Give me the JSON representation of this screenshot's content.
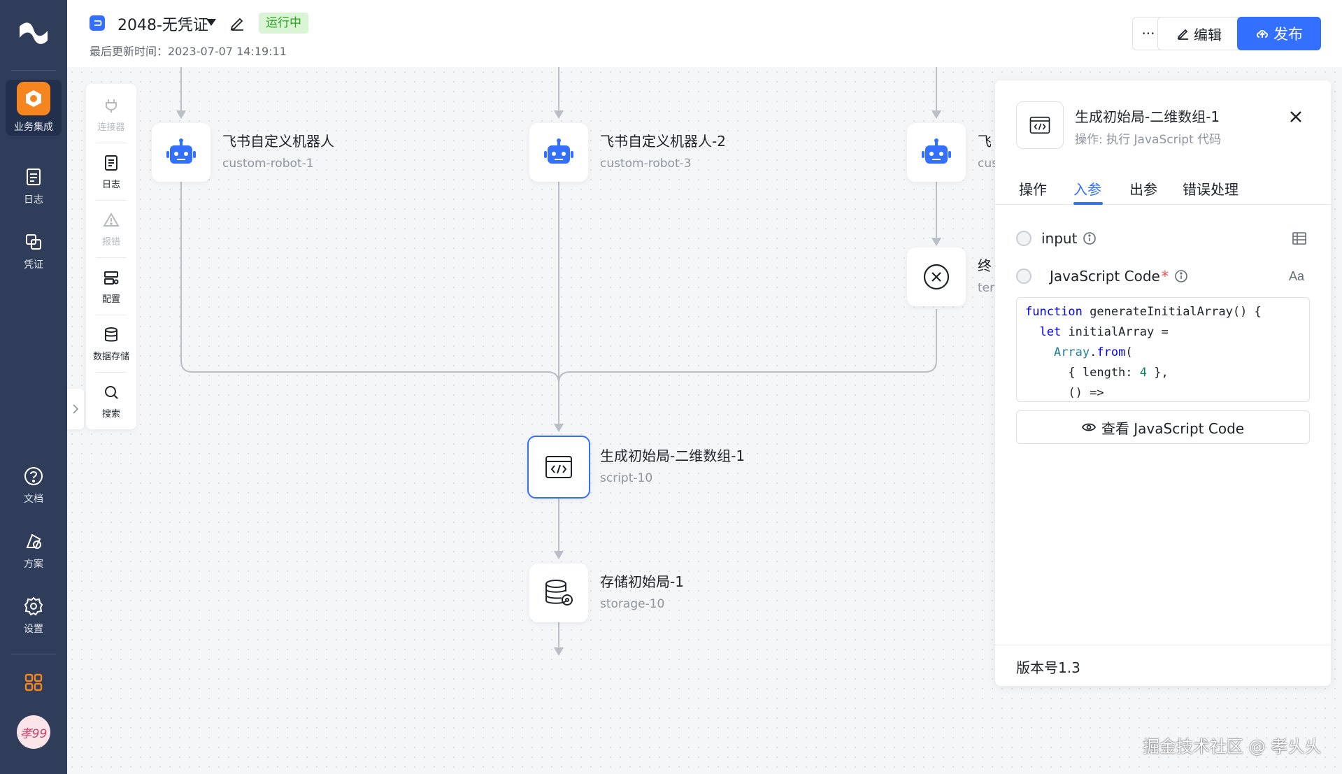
{
  "leftnav": {
    "items": [
      {
        "label": "业务集成",
        "icon": "integration-icon"
      },
      {
        "label": "日志",
        "icon": "log-icon"
      },
      {
        "label": "凭证",
        "icon": "credential-icon"
      },
      {
        "label": "文档",
        "icon": "help-icon"
      },
      {
        "label": "方案",
        "icon": "solution-icon"
      },
      {
        "label": "设置",
        "icon": "settings-icon"
      }
    ],
    "avatar_text": "孝99"
  },
  "header": {
    "app_icon": "app-flow-icon",
    "title": "2048-无凭证",
    "status": "运行中",
    "updated": "最后更新时间：2023-07-07 14:19:11",
    "more_label": "···",
    "edit_label": "编辑",
    "publish_label": "发布"
  },
  "tools": {
    "items": [
      {
        "label": "连接器",
        "icon": "plug-icon",
        "disabled": true
      },
      {
        "label": "日志",
        "icon": "log-icon",
        "disabled": false
      },
      {
        "label": "报错",
        "icon": "warning-icon",
        "disabled": true
      },
      {
        "label": "配置",
        "icon": "config-icon",
        "disabled": false
      },
      {
        "label": "数据存储",
        "icon": "database-icon",
        "disabled": false
      },
      {
        "label": "搜索",
        "icon": "search-icon",
        "disabled": false
      }
    ]
  },
  "nodes": {
    "robot1": {
      "title": "飞书自定义机器人",
      "sub": "custom-robot-1"
    },
    "robot3": {
      "title": "飞书自定义机器人-2",
      "sub": "custom-robot-3"
    },
    "robot_partial": {
      "title": "飞",
      "sub": "cus"
    },
    "terminate": {
      "title": "终",
      "sub": "ter"
    },
    "script": {
      "title": "生成初始局-二维数组-1",
      "sub": "script-10"
    },
    "storage": {
      "title": "存储初始局-1",
      "sub": "storage-10"
    }
  },
  "panel": {
    "title": "生成初始局-二维数组-1",
    "subtitle": "操作: 执行 JavaScript 代码",
    "tabs": [
      "操作",
      "入参",
      "出参",
      "错误处理"
    ],
    "active_tab": "入参",
    "params": [
      {
        "name": "input",
        "required": false
      },
      {
        "name": "JavaScript Code",
        "required": true
      }
    ],
    "code_lines": [
      "function generateInitialArray() {",
      "  let initialArray =",
      "    Array.from(",
      "      { length: 4 },",
      "      () =>"
    ],
    "view_code_label": "查看 JavaScript Code",
    "version": "版本号1.3"
  },
  "watermark": "掘金技术社区 @ 孝乆乆",
  "colors": {
    "primary": "#3370ff",
    "nav_bg": "#2f3c5a",
    "accent": "#f5851f",
    "running": "#2ea121"
  }
}
